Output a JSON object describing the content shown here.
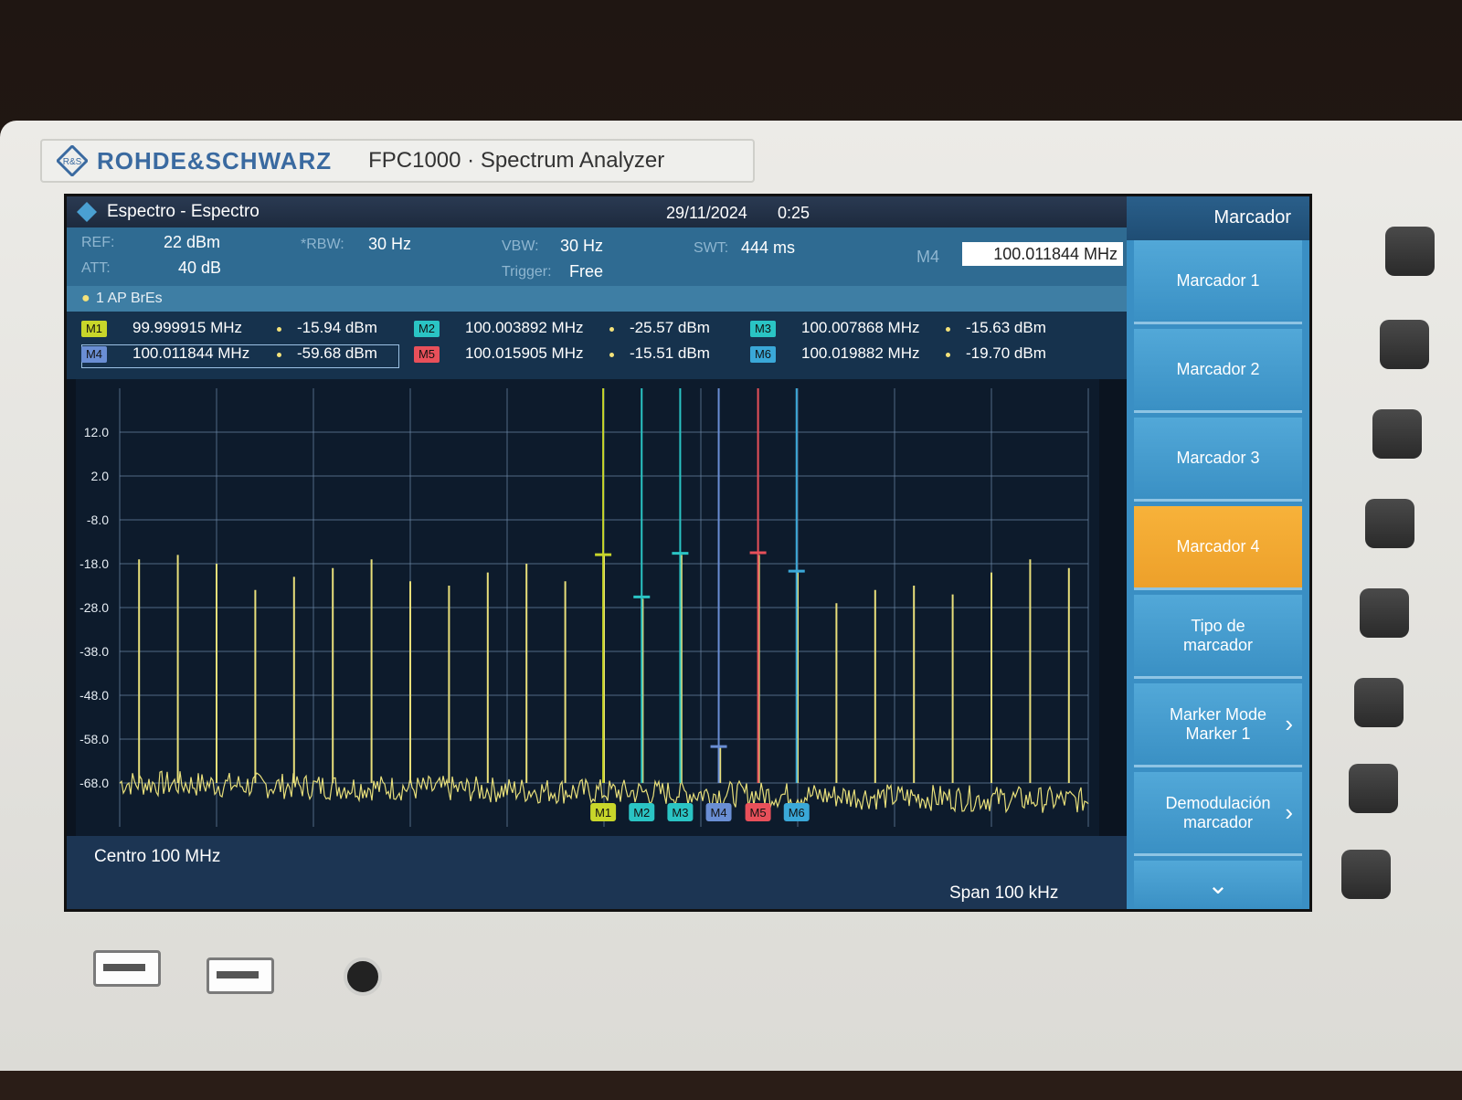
{
  "brand": {
    "name": "ROHDE&SCHWARZ",
    "model": "FPC1000 · Spectrum Analyzer",
    "logo_text": "R&S"
  },
  "titlebar": {
    "app": "Espectro - Espectro",
    "date": "29/11/2024",
    "time": "0:25"
  },
  "params": {
    "ref_label": "REF:",
    "ref": "22 dBm",
    "att_label": "ATT:",
    "att": "40 dB",
    "rbw_label": "*RBW:",
    "rbw": "30 Hz",
    "vbw_label": "VBW:",
    "vbw": "30 Hz",
    "trigger_label": "Trigger:",
    "trigger": "Free",
    "swt_label": "SWT:",
    "swt": "444 ms"
  },
  "trace_label": "1 AP  BrEs",
  "markers": [
    {
      "tag": "M1",
      "freq": "99.999915",
      "unit": "MHz",
      "level": "-15.94 dBm",
      "color": "#c8d62a",
      "freq_khz_offset": -0.085,
      "level_dbm": -15.94
    },
    {
      "tag": "M2",
      "freq": "100.003892",
      "unit": "MHz",
      "level": "-25.57 dBm",
      "color": "#2ac4c4",
      "freq_khz_offset": 3.892,
      "level_dbm": -25.57
    },
    {
      "tag": "M3",
      "freq": "100.007868",
      "unit": "MHz",
      "level": "-15.63 dBm",
      "color": "#2ac4c4",
      "freq_khz_offset": 7.868,
      "level_dbm": -15.63
    },
    {
      "tag": "M4",
      "freq": "100.011844",
      "unit": "MHz",
      "level": "-59.68 dBm",
      "color": "#6a8ed4",
      "freq_khz_offset": 11.844,
      "level_dbm": -59.68
    },
    {
      "tag": "M5",
      "freq": "100.015905",
      "unit": "MHz",
      "level": "-15.51 dBm",
      "color": "#e8505a",
      "freq_khz_offset": 15.905,
      "level_dbm": -15.51
    },
    {
      "tag": "M6",
      "freq": "100.019882",
      "unit": "MHz",
      "level": "-19.70 dBm",
      "color": "#3aa8d8",
      "freq_khz_offset": 19.882,
      "level_dbm": -19.7
    }
  ],
  "colors": {
    "trace": "#e8df7a",
    "grid": "#6f8aa8",
    "active_softkey": "#f2a933",
    "softkey": "#4aa0d2"
  },
  "chart_data": {
    "type": "line",
    "title": "",
    "xlabel": "",
    "ylabel": "",
    "y_ticks": [
      "12.0",
      "2.0",
      "-8.0",
      "-18.0",
      "-28.0",
      "-38.0",
      "-48.0",
      "-58.0",
      "-68.0"
    ],
    "ylim": [
      -78,
      22
    ],
    "xlim_khz": [
      -50,
      50
    ],
    "center": "Centro 100 MHz",
    "span": "Span 100 kHz",
    "noise_floor_dbm": -68,
    "tones_khz": [
      -48,
      -44,
      -40,
      -36,
      -32,
      -28,
      -24,
      -20,
      -16,
      -12,
      -8,
      -4,
      0,
      4,
      8,
      12,
      16,
      20,
      24,
      28,
      32,
      36,
      40,
      44,
      48
    ],
    "tones_dbm": [
      -17,
      -16,
      -18,
      -24,
      -21,
      -19,
      -17,
      -22,
      -23,
      -20,
      -18,
      -22,
      -16,
      -26,
      -16,
      -60,
      -16,
      -20,
      -27,
      -24,
      -23,
      -25,
      -20,
      -17,
      -19
    ]
  },
  "softkeys": {
    "header": "Marcador",
    "m4_label": "M4",
    "m4_value": "100.011844 MHz",
    "items": [
      {
        "label": "Marcador 1"
      },
      {
        "label": "Marcador 2"
      },
      {
        "label": "Marcador 3"
      },
      {
        "label": "Marcador 4"
      },
      {
        "label": "Tipo de marcador"
      },
      {
        "label": "Marker Mode Marker 1"
      },
      {
        "label": "Demodulación marcador"
      }
    ],
    "more": "⌄"
  },
  "footer": {
    "center": "Centro 100 MHz",
    "span": "Span 100 kHz"
  }
}
